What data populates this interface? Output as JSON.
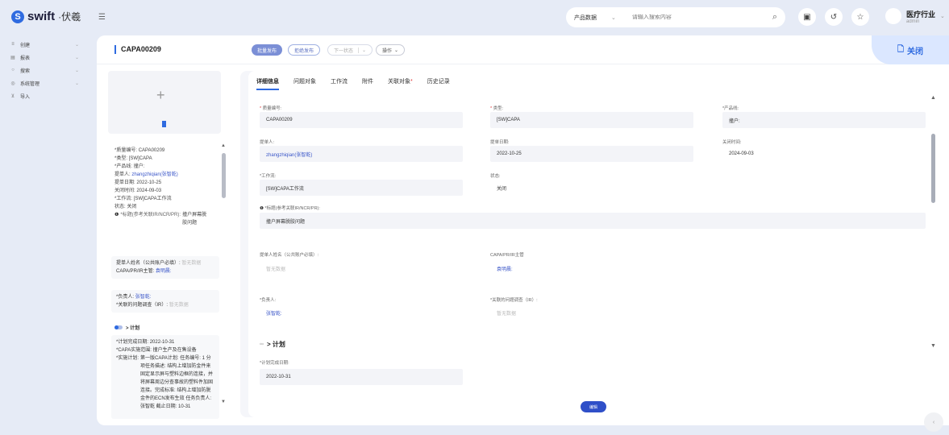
{
  "brand": {
    "mark": "S",
    "name": "swift",
    "sub": "·伏羲",
    "menu_icon": "menu-icon"
  },
  "search": {
    "category": "产品数据",
    "placeholder": "请输入搜索内容"
  },
  "org": {
    "name": "医疗行业",
    "user": "admin"
  },
  "sidebar": {
    "items": [
      {
        "icon": "≡",
        "label": "创建"
      },
      {
        "icon": "▤",
        "label": "报表"
      },
      {
        "icon": "○",
        "label": "搜索"
      },
      {
        "icon": "◎",
        "label": "系统管理"
      },
      {
        "icon": "⊻",
        "label": "导入"
      }
    ]
  },
  "doc": {
    "title": "CAPA00209"
  },
  "toolbar": {
    "batch_publish": "批量发布",
    "reject_publish": "拒绝发布",
    "next_status": "下一状态",
    "operations": "操作",
    "close": "关闭"
  },
  "left": {
    "rows": [
      {
        "label": "*质量编号:",
        "value": "CAPA00209"
      },
      {
        "label": "*类型:",
        "value": "[SW]CAPA"
      },
      {
        "label": "*产品线:",
        "value": "撞户:"
      },
      {
        "label": "提单人:",
        "value": "zhangzhiqian(张智乾)"
      },
      {
        "label": "提单日期:",
        "value": "2022-10-25"
      },
      {
        "label": "关闭时间:",
        "value": "2024-09-03"
      },
      {
        "label": "*工作流:",
        "value": "[SW]CAPA工作流"
      },
      {
        "label": "状态:",
        "value": "关闭"
      },
      {
        "label": "*标题(参考关联IR/NCR/PR):",
        "value": "撞户屏幕脱胶问题"
      }
    ],
    "card1": [
      {
        "label": "提单人姓名（公共账户必填）:",
        "value": "暂无数据"
      },
      {
        "label": "CAPA/PR/IR主管:",
        "value": "袁明晨:"
      }
    ],
    "card2": [
      {
        "label": "*负责人:",
        "value": "张智乾:"
      },
      {
        "label": "*关联的问题调查（IR）:",
        "value": "暂无数据"
      }
    ],
    "plan_head": "> 计划",
    "card3": [
      {
        "label": "*计划完成日期:",
        "value": "2022-10-31"
      },
      {
        "label": "*CAPA实施范围:",
        "value": "撞户生产及在售设备"
      },
      {
        "label": "*实施计划:",
        "value": "第一版CAPA计划: 任务编号: 1 分项任务描述: 结构上增加防金件来固定显示屏与塑料边框的连接，并将屏幕周边分查事故的塑料件加固连接。完成标准: 结构上增加防脱金件的ECN发布生效 任务负责人: 张智乾 截止日期: 10-31"
      }
    ]
  },
  "tabs": [
    {
      "label": "详细信息",
      "req": ""
    },
    {
      "label": "问题对象",
      "req": ""
    },
    {
      "label": "工作流",
      "req": ""
    },
    {
      "label": "附件",
      "req": ""
    },
    {
      "label": "关联对象",
      "req": "*"
    },
    {
      "label": "历史记录",
      "req": ""
    }
  ],
  "form": {
    "quality_no": {
      "label": "质量编号:",
      "value": "CAPA00209"
    },
    "type": {
      "label": "类型:",
      "value": "[SW]CAPA"
    },
    "product_line": {
      "label": "*产品线:",
      "value": "撞户:"
    },
    "submitter": {
      "label": "提单人:",
      "value": "zhangzhiqian(张智乾)"
    },
    "submit_date": {
      "label": "提单日期:",
      "value": "2022-10-25"
    },
    "close_time": {
      "label": "关闭时间:",
      "value": "2024-09-03"
    },
    "workflow": {
      "label": "*工作流:",
      "value": "[SW]CAPA工作流"
    },
    "status": {
      "label": "状态:",
      "value": "关闭"
    },
    "title": {
      "label": "*标题(参考关联IR/NCR/PR):",
      "value": "撞户屏幕脱胶问题"
    },
    "submitter_name": {
      "label": "提单人姓名（公共账户必填）:",
      "value": "暂无数据"
    },
    "capa_manager": {
      "label": "CAPA/PR/IR主管",
      "value": "袁明晨:"
    },
    "owner": {
      "label": "*负责人:",
      "value": "张智乾:"
    },
    "related_ir": {
      "label": "*关联的问题调查（IR）:",
      "value": "暂无数据"
    },
    "plan_section": "> 计划",
    "plan_date": {
      "label": "*计划完成日期:",
      "value": "2022-10-31"
    },
    "edit": "编辑"
  },
  "colors": {
    "accent": "#2f6be0",
    "page_bg": "#e6ebf6",
    "link": "#3a56c8"
  }
}
